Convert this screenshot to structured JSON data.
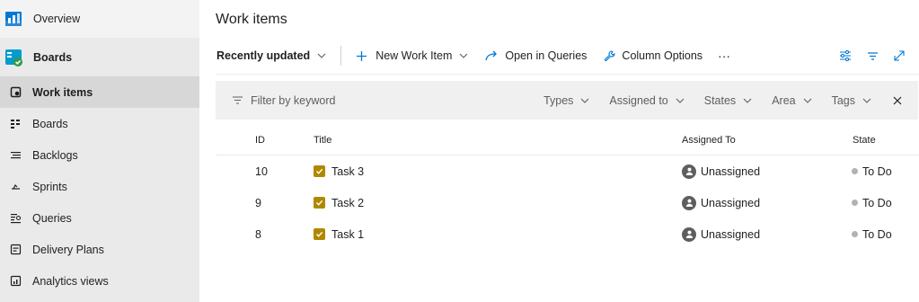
{
  "sidebar": {
    "overview_label": "Overview",
    "boards_header_label": "Boards",
    "items": [
      {
        "label": "Work items",
        "icon": "work-items-icon"
      },
      {
        "label": "Boards",
        "icon": "boards-icon"
      },
      {
        "label": "Backlogs",
        "icon": "backlogs-icon"
      },
      {
        "label": "Sprints",
        "icon": "sprints-icon"
      },
      {
        "label": "Queries",
        "icon": "queries-icon"
      },
      {
        "label": "Delivery Plans",
        "icon": "delivery-plans-icon"
      },
      {
        "label": "Analytics views",
        "icon": "analytics-views-icon"
      }
    ],
    "active_index": 0
  },
  "main": {
    "page_title": "Work items",
    "toolbar": {
      "view_label": "Recently updated",
      "new_item_label": "New Work Item",
      "open_queries_label": "Open in Queries",
      "column_options_label": "Column Options",
      "more_label": "···"
    },
    "filter": {
      "placeholder": "Filter by keyword",
      "pills": [
        "Types",
        "Assigned to",
        "States",
        "Area",
        "Tags"
      ]
    },
    "table": {
      "columns": [
        "ID",
        "Title",
        "Assigned To",
        "State"
      ],
      "rows": [
        {
          "id": "10",
          "title": "Task 3",
          "assigned_to": "Unassigned",
          "state": "To Do"
        },
        {
          "id": "9",
          "title": "Task 2",
          "assigned_to": "Unassigned",
          "state": "To Do"
        },
        {
          "id": "8",
          "title": "Task 1",
          "assigned_to": "Unassigned",
          "state": "To Do"
        }
      ]
    }
  },
  "colors": {
    "accent": "#0078d4",
    "task": "#b08800",
    "sidebar_bg": "#eaeaea",
    "active_bg": "#d7d7d7",
    "state_dot": "#b2b2b2"
  }
}
